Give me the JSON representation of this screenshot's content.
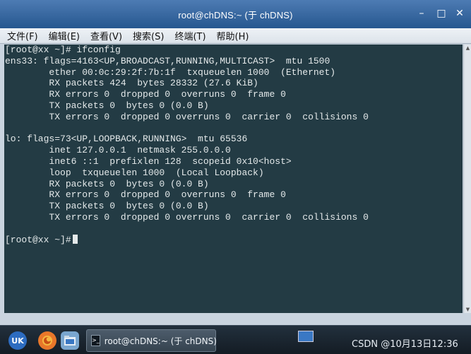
{
  "window": {
    "title": "root@chDNS:~ (于 chDNS)",
    "controls": {
      "minimize": "–",
      "maximize": "□",
      "close": "✕"
    }
  },
  "menu": {
    "items": [
      "文件(F)",
      "编辑(E)",
      "查看(V)",
      "搜索(S)",
      "终端(T)",
      "帮助(H)"
    ]
  },
  "terminal": {
    "lines": [
      "[root@xx ~]# ifconfig",
      "ens33: flags=4163<UP,BROADCAST,RUNNING,MULTICAST>  mtu 1500",
      "        ether 00:0c:29:2f:7b:1f  txqueuelen 1000  (Ethernet)",
      "        RX packets 424  bytes 28332 (27.6 KiB)",
      "        RX errors 0  dropped 0  overruns 0  frame 0",
      "        TX packets 0  bytes 0 (0.0 B)",
      "        TX errors 0  dropped 0 overruns 0  carrier 0  collisions 0",
      "",
      "lo: flags=73<UP,LOOPBACK,RUNNING>  mtu 65536",
      "        inet 127.0.0.1  netmask 255.0.0.0",
      "        inet6 ::1  prefixlen 128  scopeid 0x10<host>",
      "        loop  txqueuelen 1000  (Local Loopback)",
      "        RX packets 0  bytes 0 (0.0 B)",
      "        RX errors 0  dropped 0  overruns 0  frame 0",
      "        TX packets 0  bytes 0 (0.0 B)",
      "        TX errors 0  dropped 0 overruns 0  carrier 0  collisions 0",
      "",
      "[root@xx ~]#"
    ],
    "colors": {
      "background": "#233b44",
      "text": "#e4e9ea"
    }
  },
  "taskbar": {
    "launcher_icons": [
      "uk-start-icon",
      "firefox-icon",
      "files-icon"
    ],
    "launcher_labels": [
      "UK",
      "",
      ""
    ],
    "task_label": "root@chDNS:~ (于 chDNS)",
    "tray_text": "CSDN @10月13日12:36"
  }
}
